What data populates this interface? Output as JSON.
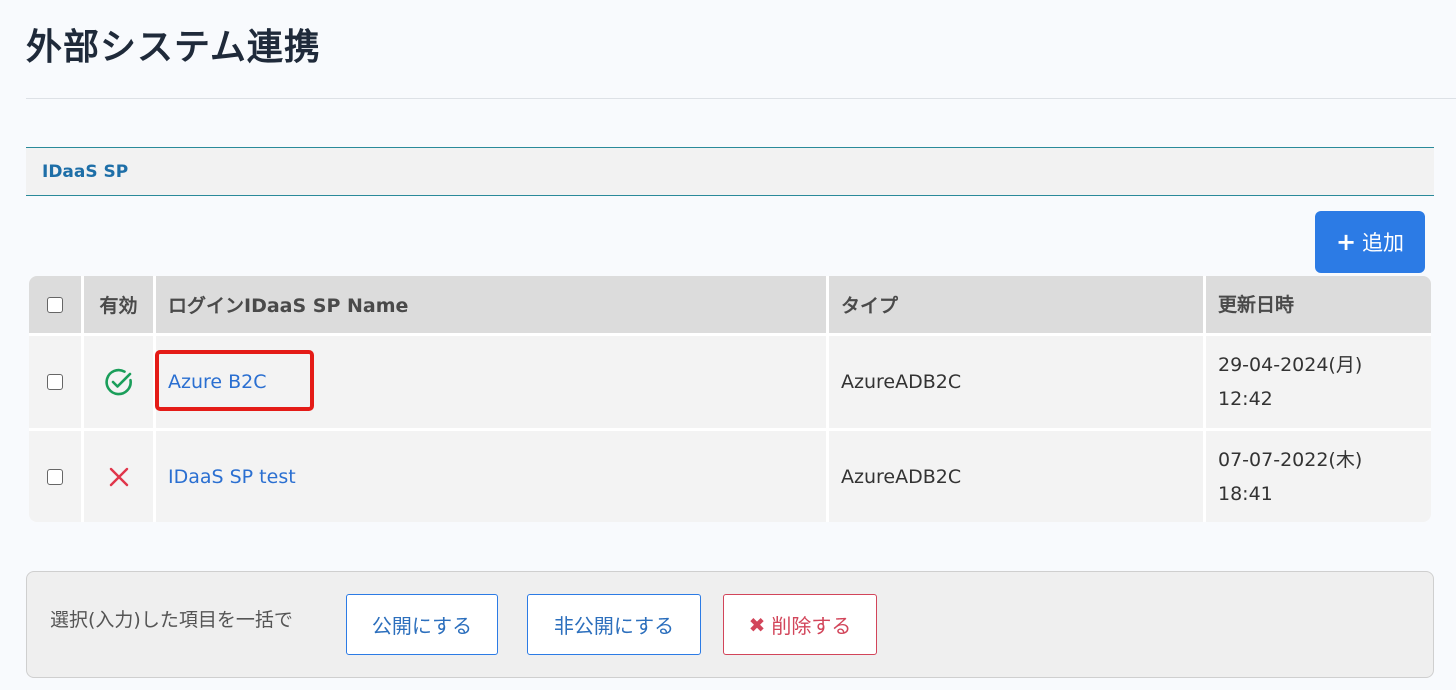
{
  "page": {
    "title": "外部システム連携"
  },
  "section": {
    "title": "IDaaS SP"
  },
  "toolbar": {
    "add_icon": "+",
    "add_label": "追加"
  },
  "table": {
    "columns": [
      "有効",
      "ログインIDaaS SP Name",
      "タイプ",
      "更新日時"
    ],
    "rows": [
      {
        "enabled": true,
        "enabled_icon": "check-circle-icon",
        "name": "Azure B2C",
        "type": "AzureADB2C",
        "date": "29-04-2024(月)",
        "time": "12:42"
      },
      {
        "enabled": false,
        "enabled_icon": "x-mark-icon",
        "name": "IDaaS SP test",
        "type": "AzureADB2C",
        "date": "07-07-2022(木)",
        "time": "18:41"
      }
    ]
  },
  "bulk": {
    "label": "選択(入力)した項目を一括で",
    "public_label": "公開にする",
    "private_label": "非公開にする",
    "delete_icon": "✖",
    "delete_label": "削除する"
  },
  "colors": {
    "accent": "#2c7be5",
    "enabled": "#1a9e5a",
    "disabled": "#e0354a",
    "highlight": "#e41b17"
  }
}
